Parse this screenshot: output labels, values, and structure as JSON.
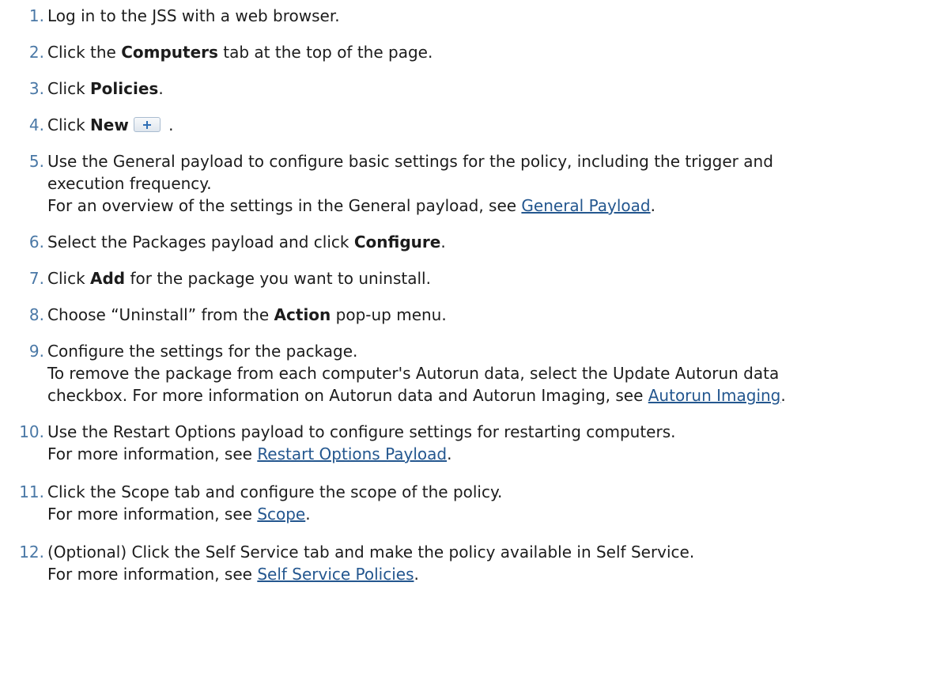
{
  "steps": [
    {
      "number": "1.",
      "parts": [
        "Log in to the JSS with a web browser."
      ]
    },
    {
      "number": "2.",
      "before": "Click the ",
      "bold": "Computers",
      "after": " tab at the top of the page."
    },
    {
      "number": "3.",
      "before": "Click ",
      "bold": "Policies",
      "after": "."
    },
    {
      "number": "4.",
      "before": "Click ",
      "bold": "New",
      "after": " .",
      "icon": "plus-icon"
    },
    {
      "number": "5.",
      "line1": "Use the General payload to configure basic settings for the policy, including the trigger and",
      "line2": "execution frequency.",
      "line3_before": "For an overview of the settings in the General payload, see ",
      "link": "General Payload",
      "line3_after": "."
    },
    {
      "number": "6.",
      "before": "Select the Packages payload and click ",
      "bold": "Configure",
      "after": "."
    },
    {
      "number": "7.",
      "before": "Click ",
      "bold": "Add",
      "after": " for the package you want to uninstall."
    },
    {
      "number": "8.",
      "before": "Choose “Uninstall” from the ",
      "bold": "Action",
      "after": " pop-up menu."
    },
    {
      "number": "9.",
      "line1": "Configure the settings for the package.",
      "line2": "To remove the package from each computer's Autorun data, select the Update Autorun data",
      "line3_before": "checkbox. For more information on Autorun data and Autorun Imaging, see ",
      "link": "Autorun Imaging",
      "line3_after": "."
    },
    {
      "number": "10.",
      "line1": "Use the Restart Options payload to configure settings for restarting computers.",
      "line2_before": "For more information, see ",
      "link": "Restart Options Payload",
      "line2_after": "."
    },
    {
      "number": "11.",
      "line1": "Click the Scope tab and configure the scope of the policy.",
      "line2_before": "For more information, see ",
      "link": "Scope",
      "line2_after": "."
    },
    {
      "number": "12.",
      "line1": "(Optional) Click the Self Service tab and make the policy available in Self Service.",
      "line2_before": "For more information, see ",
      "link": "Self Service Policies",
      "line2_after": "."
    }
  ],
  "colors": {
    "step_number": "#4a78a6",
    "link": "#24578f",
    "text": "#1c1c1c"
  }
}
